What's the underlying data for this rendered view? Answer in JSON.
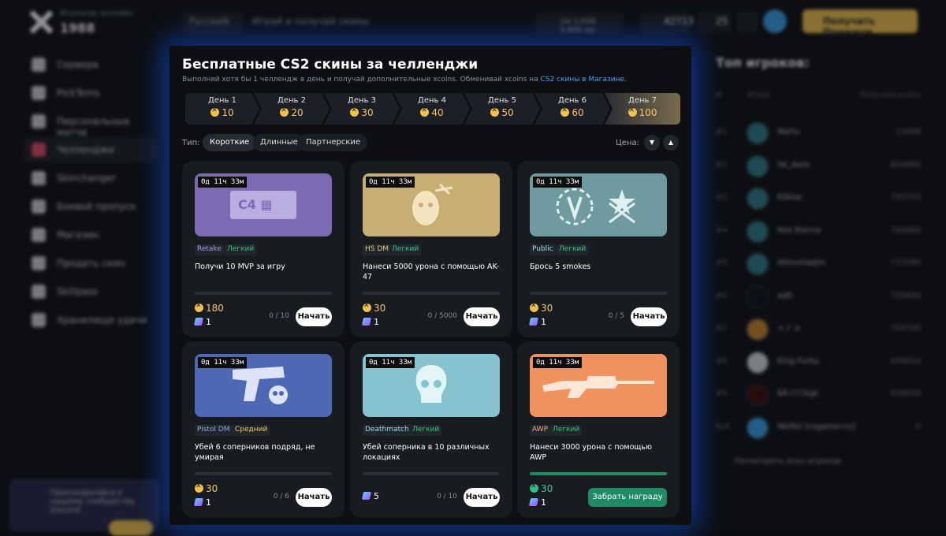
{
  "header": {
    "online_label": "Игроков онлайн",
    "online_count": "1988",
    "language": "Русский",
    "tagline": "Играй и получай скины",
    "rank": "1м 1.026 3.600 кр",
    "coins": "42713",
    "gems": "25",
    "premium_label": "Получить Премиум"
  },
  "sidebar": {
    "items": [
      {
        "label": "Сервера"
      },
      {
        "label": "PickTems"
      },
      {
        "label": "Персональные матчи"
      },
      {
        "label": "Челленджи"
      },
      {
        "label": "Skinchanger"
      },
      {
        "label": "Боевой пропуск"
      },
      {
        "label": "Магазин"
      },
      {
        "label": "Продать скин"
      },
      {
        "label": "Skillpass"
      },
      {
        "label": "Хранилище удачи"
      }
    ],
    "discord_text": "Присоединяйся к нашему сообществу Discord"
  },
  "modal": {
    "title": "Бесплатные CS2 скины за челленджи",
    "subtitle": "Выполняй хотя бы 1 челлендж в день и получай дополнительные xcoins. Обменивай xcoins на",
    "subtitle_link": "CS2 скины в Магазине",
    "days": [
      {
        "label": "День 1",
        "reward": "10"
      },
      {
        "label": "День 2",
        "reward": "20"
      },
      {
        "label": "День 3",
        "reward": "30"
      },
      {
        "label": "День 4",
        "reward": "40"
      },
      {
        "label": "День 5",
        "reward": "50"
      },
      {
        "label": "День 6",
        "reward": "60"
      },
      {
        "label": "День 7",
        "reward": "100"
      }
    ],
    "filter_label": "Тип:",
    "filters": [
      {
        "label": "Короткие"
      },
      {
        "label": "Длинные"
      },
      {
        "label": "Партнерские"
      }
    ],
    "price_label": "Цена:",
    "cards": [
      {
        "timer": "0д 11ч 33м",
        "mode": "Retake",
        "difficulty": "Легкий",
        "task": "Получи 10 MVP за игру",
        "coins": "180",
        "gems": "1",
        "progress": "0 / 10",
        "action": "Начать",
        "image_text": "C4"
      },
      {
        "timer": "0д 11ч 33м",
        "mode": "HS DM",
        "difficulty": "Легкий",
        "task": "Нанеси 5000 урона с помощью AK-47",
        "coins": "30",
        "gems": "1",
        "progress": "0 / 5000",
        "action": "Начать"
      },
      {
        "timer": "0д 11ч 33м",
        "mode": "Public",
        "difficulty": "Легкий",
        "task": "Брось 5 smokes",
        "coins": "30",
        "gems": "1",
        "progress": "0 / 5",
        "action": "Начать"
      },
      {
        "timer": "0д 11ч 33м",
        "mode": "Pistol DM",
        "difficulty": "Средний",
        "task": "Убей 6 соперников подряд, не умирая",
        "coins": "30",
        "gems": "1",
        "progress": "0 / 6",
        "action": "Начать"
      },
      {
        "timer": "0д 11ч 33м",
        "mode": "Deathmatch",
        "difficulty": "Легкий",
        "task": "Убей соперника в 10 различных локациях",
        "coins": "",
        "gems": "5",
        "progress": "0 / 10",
        "action": "Начать"
      },
      {
        "timer": "0д 11ч 33м",
        "mode": "AWP",
        "difficulty": "Легкий",
        "task": "Нанеси 3000 урона с помощью AWP",
        "coins": "30",
        "gems": "1",
        "progress": "",
        "action": "Забрать награду",
        "progress_fill": 1.0
      }
    ]
  },
  "leaderboard": {
    "title": "Топ игроков:",
    "col_rank": "#",
    "col_player": "Игрок",
    "col_coins": "Получено xcoins",
    "rows": [
      {
        "rank": "#1",
        "name": "Marlu",
        "coins": "12696"
      },
      {
        "rank": "#2",
        "name": "SK_Aero",
        "coins": "854800"
      },
      {
        "rank": "#3",
        "name": "KSklar",
        "coins": "793743"
      },
      {
        "rank": "#4",
        "name": "Nox Eterna",
        "coins": "760860"
      },
      {
        "rank": "#5",
        "name": "Almuntaqim",
        "coins": "733180"
      },
      {
        "rank": "#6",
        "name": "adll-",
        "coins": "725840"
      },
      {
        "rank": "#7",
        "name": "-c (· a",
        "coins": "724700"
      },
      {
        "rank": "#8",
        "name": "King Furby",
        "coins": "659410"
      },
      {
        "rank": "#9",
        "name": "ßЯ.ΞΞΞkgt.",
        "coins": "638930"
      },
      {
        "rank": "N/A",
        "name": "Wolfer [csgamer.ru]",
        "coins": "0"
      }
    ],
    "view_all": "Посмотреть всех игроков"
  },
  "colors": {
    "accent": "#f2c14e",
    "green": "#1f8a63",
    "link": "#4a9ff5",
    "glow": "#1e5bff"
  }
}
